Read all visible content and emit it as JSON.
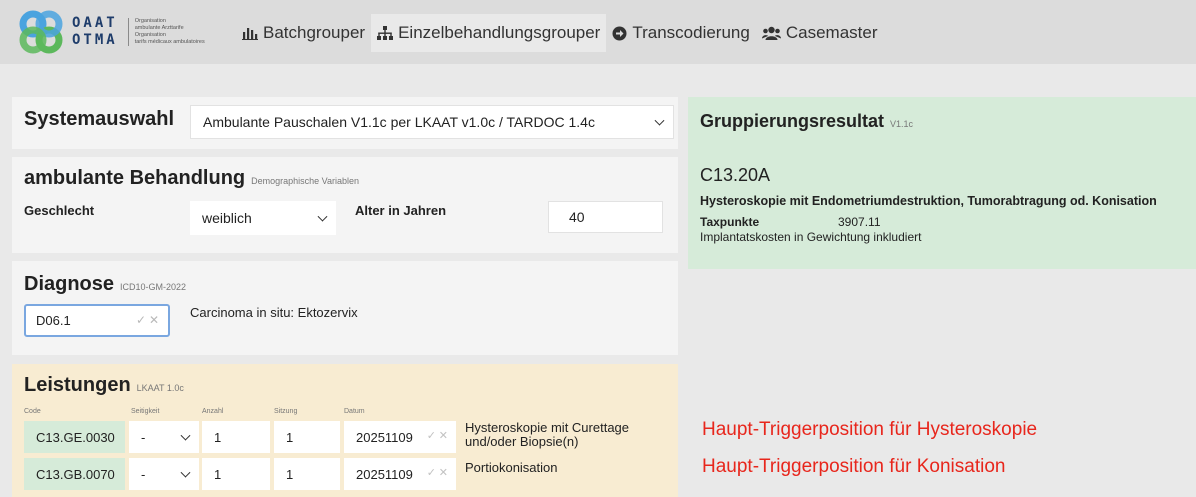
{
  "brand": {
    "line1": "OAAT",
    "line2": "OTMA",
    "sub": [
      "Organisation",
      "ambulante Arzttarife",
      "Organisation",
      "tarifs médicaux ambulatoires"
    ],
    "colors": {
      "ring_blue": "#4aa3df",
      "ring_green": "#5cb85c",
      "ring_dark": "#1f3d6b"
    }
  },
  "nav": {
    "items": [
      {
        "label": "Batchgrouper",
        "icon": "bar-chart-icon"
      },
      {
        "label": "Einzelbehandlungsgrouper",
        "icon": "sitemap-icon"
      },
      {
        "label": "Transcodierung",
        "icon": "arrow-circle-icon"
      },
      {
        "label": "Casemaster",
        "icon": "users-icon"
      }
    ],
    "active": "Einzelbehandlungsgrouper"
  },
  "system": {
    "title": "Systemauswahl",
    "selected": "Ambulante Pauschalen V1.1c per LKAAT v1.0c / TARDOC 1.4c"
  },
  "behandlung": {
    "title": "ambulante Behandlung",
    "subtitle": "Demographische Variablen",
    "sex_label": "Geschlecht",
    "sex_value": "weiblich",
    "age_label": "Alter in Jahren",
    "age_value": "40"
  },
  "diagnose": {
    "title": "Diagnose",
    "subtitle": "ICD10-GM-2022",
    "code": "D06.1",
    "text": "Carcinoma in situ: Ektozervix"
  },
  "leistungen": {
    "title": "Leistungen",
    "subtitle": "LKAAT 1.0c",
    "columns": [
      "Code",
      "Seitigkeit",
      "Anzahl",
      "Sitzung",
      "Datum"
    ],
    "rows": [
      {
        "code": "C13.GE.0030",
        "side": "-",
        "count": "1",
        "session": "1",
        "date": "20251109",
        "desc": "Hysteroskopie mit Curettage und/oder Biopsie(n)"
      },
      {
        "code": "C13.GB.0070",
        "side": "-",
        "count": "1",
        "session": "1",
        "date": "20251109",
        "desc": "Portiokonisation"
      }
    ]
  },
  "result": {
    "title": "Gruppierungsresultat",
    "version": "V1.1c",
    "code": "C13.20A",
    "desc": "Hysteroskopie mit Endometriumdestruktion, Tumorabtragung od. Konisation",
    "tax_label": "Taxpunkte",
    "tax_value": "3907.11",
    "note": "Implantatskosten in Gewichtung inkludiert"
  },
  "annotations": [
    "Haupt-Triggerposition für Hysteroskopie",
    "Haupt-Triggerposition für Konisation"
  ]
}
